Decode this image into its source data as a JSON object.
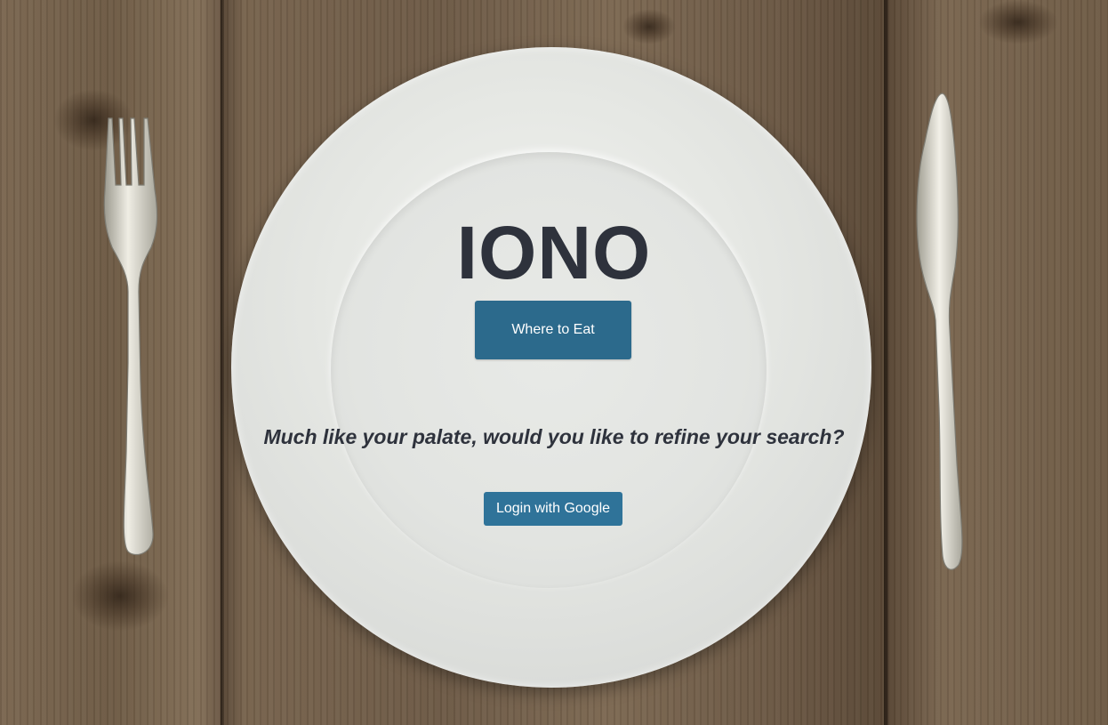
{
  "app": {
    "title": "IONO",
    "tagline": "Much like your palate, would you like to refine your search?"
  },
  "actions": {
    "where_to_eat_label": "Where to Eat",
    "login_label": "Login with Google"
  },
  "colors": {
    "primary_button": "#2c6a8c",
    "login_button": "#2f7399",
    "text_dark": "#2e323c"
  },
  "icons": {
    "fork": "fork-icon",
    "knife": "knife-icon",
    "plate": "plate-image"
  }
}
